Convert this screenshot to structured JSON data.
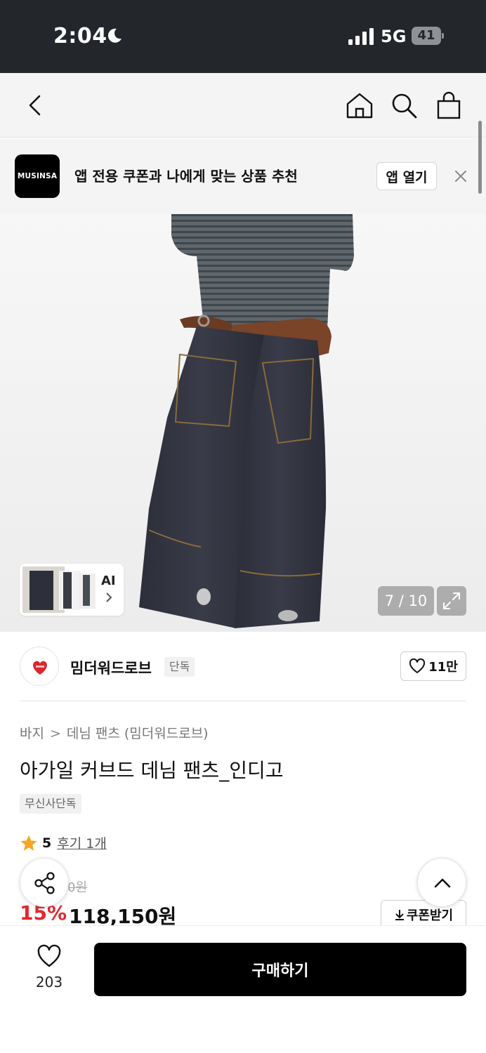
{
  "status_bar": {
    "time": "2:04",
    "network": "5G",
    "battery": "41"
  },
  "banner": {
    "logo_text": "MUSINSA",
    "message": "앱 전용 쿠폰과 나에게 맞는 상품 추천",
    "open_app_label": "앱 열기"
  },
  "gallery": {
    "ai_label": "AI",
    "counter": "7 / 10"
  },
  "brand": {
    "name": "밈더워드로브",
    "tag": "단독",
    "likes": "11만"
  },
  "breadcrumb": {
    "category": "바지",
    "subcategory": "데님 팬츠 (밈더워드로브)"
  },
  "product": {
    "title": "아가일 커브드 데님 팬츠_인디고",
    "exclusive_badge": "무신사단독",
    "rating_score": "5",
    "reviews_label": "후기 1개",
    "original_price": "0원",
    "discount": "15%",
    "price": "118,150원",
    "coupon_label": "쿠폰받기"
  },
  "bottom_bar": {
    "wishlist_count": "203",
    "buy_label": "구매하기"
  },
  "colors": {
    "status_bg": "#23262b",
    "discount_red": "#e4272d",
    "buy_black": "#000000",
    "star": "#f5a623"
  }
}
